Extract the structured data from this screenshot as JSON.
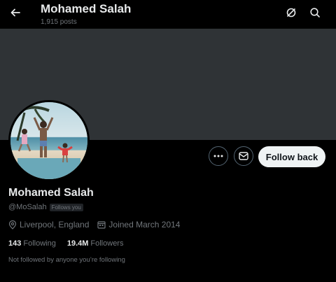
{
  "header": {
    "title": "Mohamed Salah",
    "posts_count": "1,915 posts",
    "back_icon": "arrow-left-icon",
    "grok_icon": "grok-icon",
    "search_icon": "search-icon"
  },
  "profile": {
    "name": "Mohamed Salah",
    "handle": "@MoSalah",
    "follows_you": "Follows you",
    "location": "Liverpool, England",
    "joined": "Joined March 2014",
    "following_count": "143",
    "following_label": "Following",
    "followers_count": "19.4M",
    "followers_label": "Followers",
    "followed_by_note": "Not followed by anyone you’re following"
  },
  "actions": {
    "more_icon": "more-icon",
    "message_icon": "mail-icon",
    "follow_back_label": "Follow back"
  },
  "colors": {
    "background": "#000000",
    "banner": "#2f3336",
    "text_primary": "#e7e9ea",
    "text_secondary": "#71767b",
    "follow_button_bg": "#eff3f4"
  }
}
